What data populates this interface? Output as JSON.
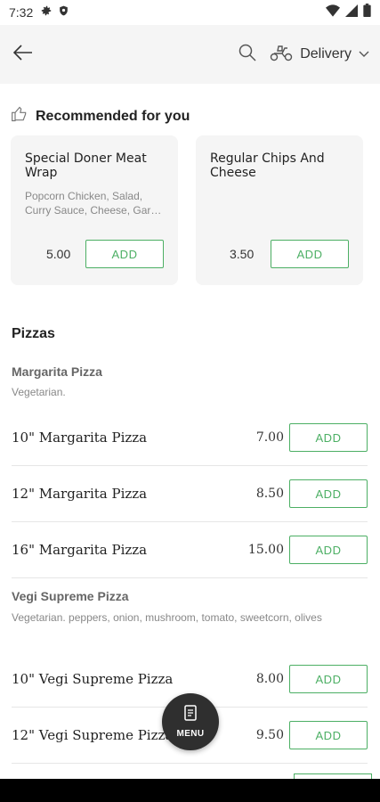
{
  "status_bar": {
    "time": "7:32"
  },
  "header": {
    "delivery_label": "Delivery"
  },
  "recommended": {
    "title": "Recommended for you",
    "items": [
      {
        "name": "Special Doner Meat Wrap",
        "description": "Popcorn Chicken, Salad, Curry Sauce, Cheese, Gar…",
        "price": "5.00",
        "add_label": "ADD"
      },
      {
        "name": "Regular Chips And Cheese",
        "description": "",
        "price": "3.50",
        "add_label": "ADD"
      }
    ]
  },
  "menu": {
    "section_title": "Pizzas",
    "groups": [
      {
        "title": "Margarita Pizza",
        "description": "Vegetarian.",
        "items": [
          {
            "name": "10\" Margarita Pizza",
            "price": "7.00",
            "add_label": "ADD"
          },
          {
            "name": "12\" Margarita Pizza",
            "price": "8.50",
            "add_label": "ADD"
          },
          {
            "name": "16\" Margarita Pizza",
            "price": "15.00",
            "add_label": "ADD"
          }
        ]
      },
      {
        "title": "Vegi Supreme Pizza",
        "description": "Vegetarian. peppers, onion, mushroom, tomato, sweetcorn, olives",
        "items": [
          {
            "name": "10\" Vegi Supreme Pizza",
            "price": "8.00",
            "add_label": "ADD"
          },
          {
            "name": "12\" Vegi Supreme Pizza",
            "price": "9.50",
            "add_label": "ADD"
          }
        ]
      }
    ]
  },
  "fab": {
    "label": "MENU"
  },
  "colors": {
    "accent": "#4caf64",
    "fab_bg": "#2f2f2f",
    "header_bg": "#f5f5f5"
  },
  "icons": [
    "settings-icon",
    "shield-icon",
    "wifi-icon",
    "signal-icon",
    "battery-icon",
    "back-arrow-icon",
    "search-icon",
    "scooter-icon",
    "chevron-down-icon",
    "thumbs-up-icon",
    "menu-document-icon"
  ]
}
